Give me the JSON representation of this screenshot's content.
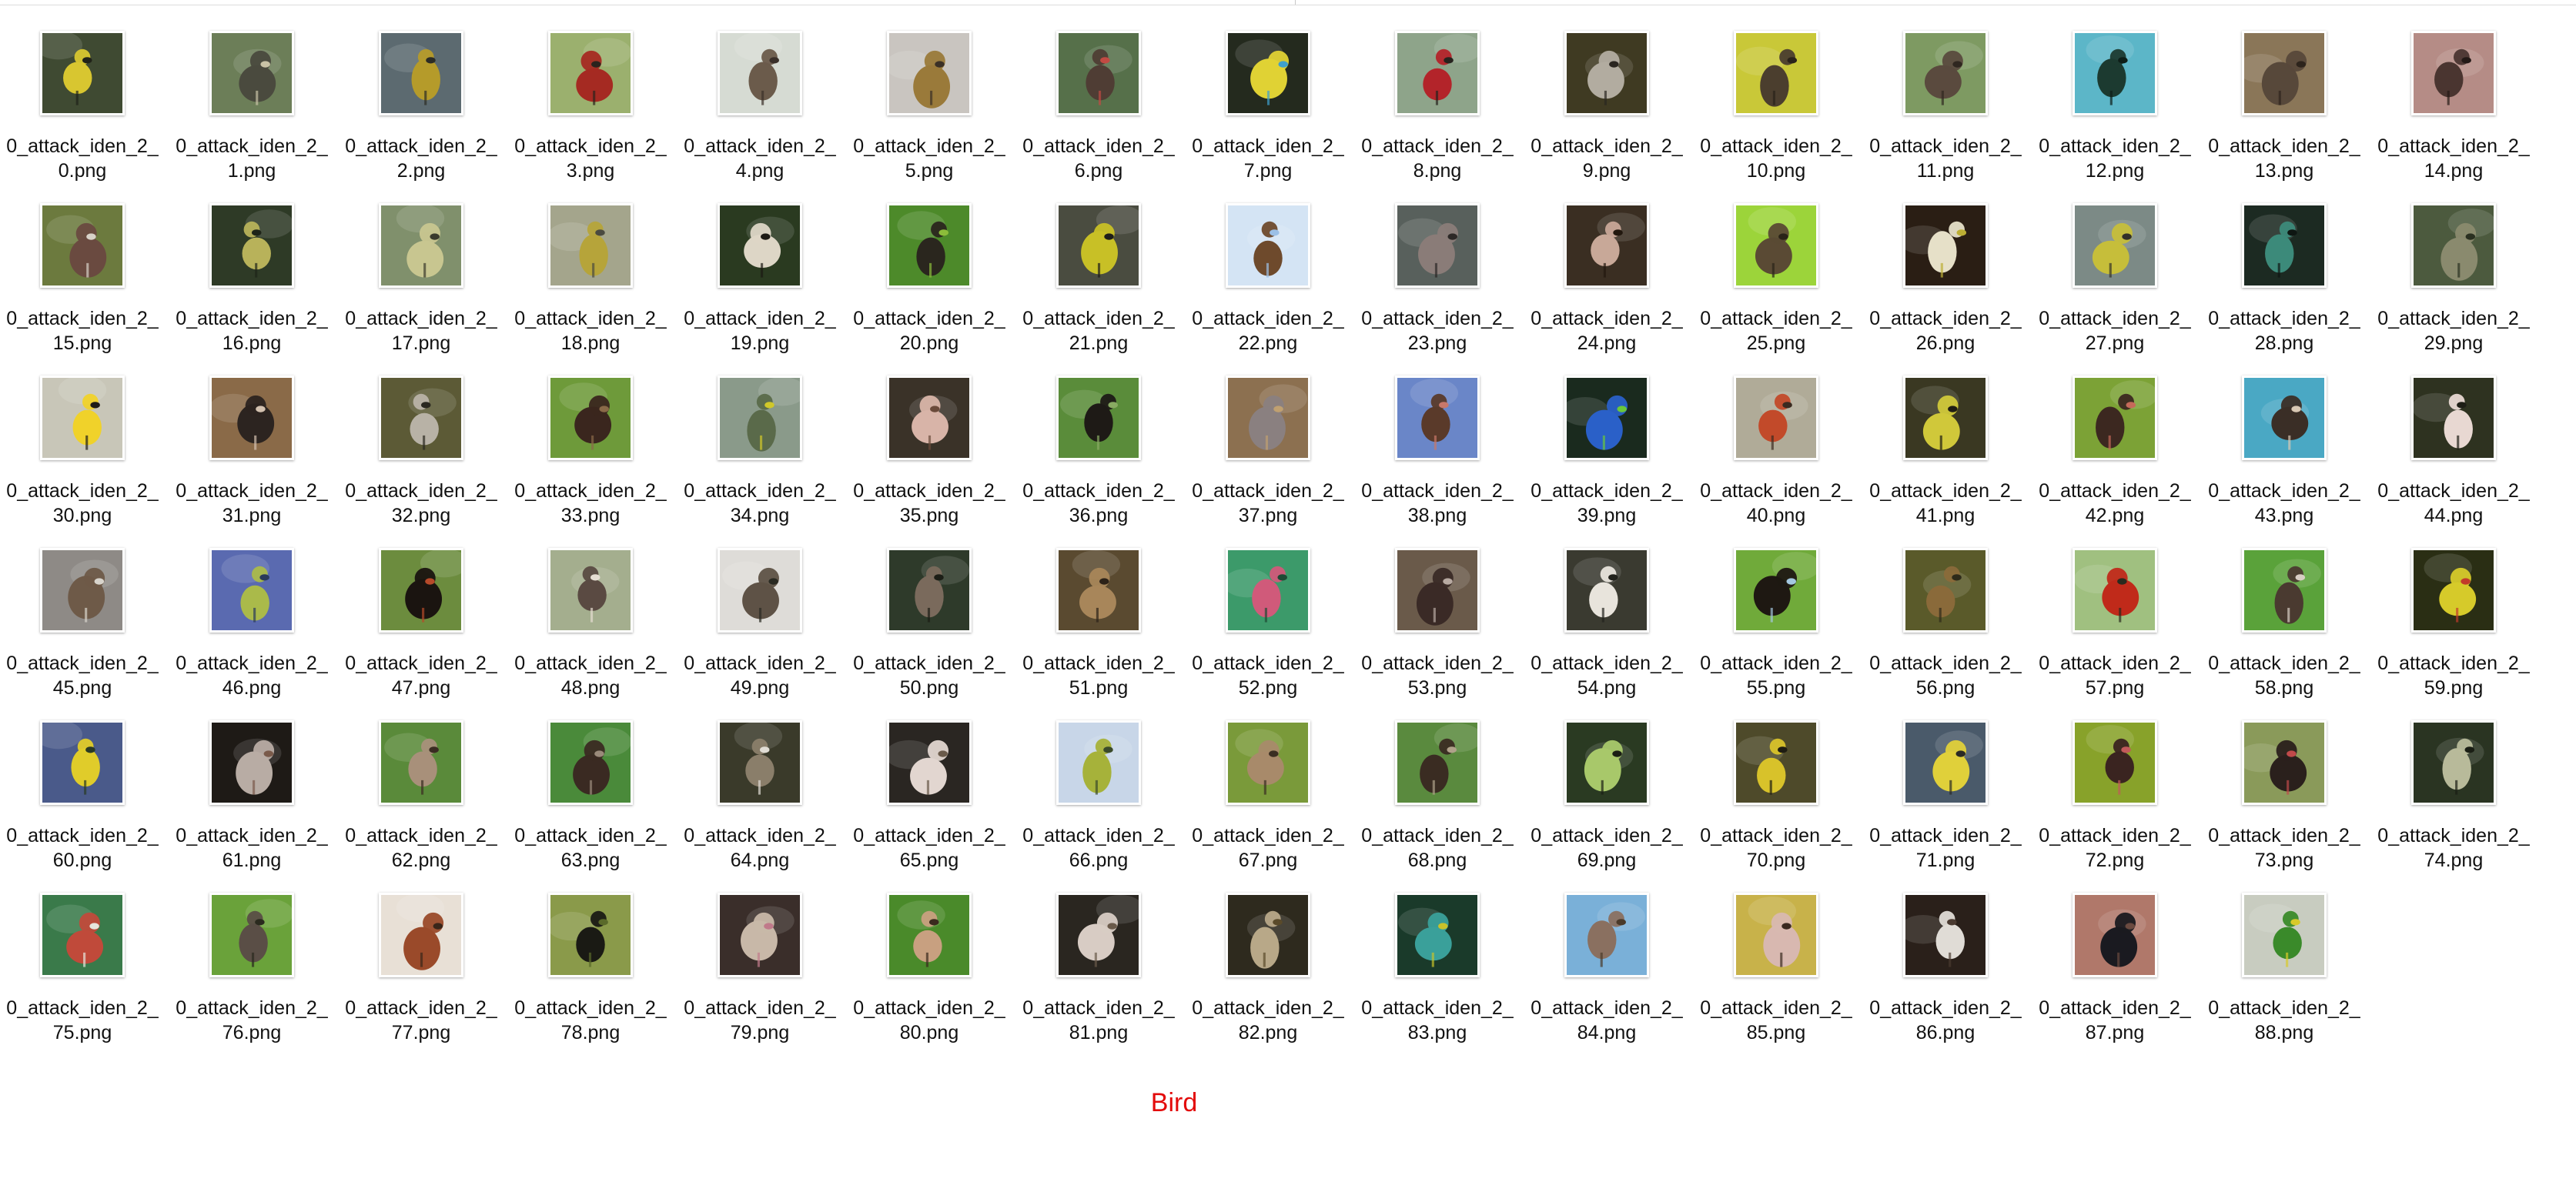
{
  "window": {
    "caption": "Bird"
  },
  "files": [
    {
      "line1": "0_attack_iden_2_",
      "line2": "0.png",
      "bg": "#3f4a32",
      "subject": "#d8c630",
      "accent": "#202218"
    },
    {
      "line1": "0_attack_iden_2_",
      "line2": "1.png",
      "bg": "#6c7e58",
      "subject": "#4a4a3e",
      "accent": "#c9c3a6"
    },
    {
      "line1": "0_attack_iden_2_",
      "line2": "2.png",
      "bg": "#5c6a70",
      "subject": "#b59b2a",
      "accent": "#2c2c25"
    },
    {
      "line1": "0_attack_iden_2_",
      "line2": "3.png",
      "bg": "#9bb06e",
      "subject": "#a52a22",
      "accent": "#2b231d"
    },
    {
      "line1": "0_attack_iden_2_",
      "line2": "4.png",
      "bg": "#d6dbd3",
      "subject": "#6b5b4b",
      "accent": "#3a302a"
    },
    {
      "line1": "0_attack_iden_2_",
      "line2": "5.png",
      "bg": "#c9c5c0",
      "subject": "#9a7a3a",
      "accent": "#3a3026"
    },
    {
      "line1": "0_attack_iden_2_",
      "line2": "6.png",
      "bg": "#56704a",
      "subject": "#4f3d34",
      "accent": "#c24a43"
    },
    {
      "line1": "0_attack_iden_2_",
      "line2": "7.png",
      "bg": "#242a1e",
      "subject": "#e0d234",
      "accent": "#3fa0cc"
    },
    {
      "line1": "0_attack_iden_2_",
      "line2": "8.png",
      "bg": "#8ea48a",
      "subject": "#b3242a",
      "accent": "#27231e"
    },
    {
      "line1": "0_attack_iden_2_",
      "line2": "9.png",
      "bg": "#3f3a22",
      "subject": "#b2aca0",
      "accent": "#2a2620"
    },
    {
      "line1": "0_attack_iden_2_",
      "line2": "10.png",
      "bg": "#c9c838",
      "subject": "#4b3e2e",
      "accent": "#2a231b"
    },
    {
      "line1": "0_attack_iden_2_",
      "line2": "11.png",
      "bg": "#7e9a62",
      "subject": "#5a4a3e",
      "accent": "#2f2720"
    },
    {
      "line1": "0_attack_iden_2_",
      "line2": "12.png",
      "bg": "#5cb6c8",
      "subject": "#1c3a30",
      "accent": "#0e1e18"
    },
    {
      "line1": "0_attack_iden_2_",
      "line2": "13.png",
      "bg": "#8a7658",
      "subject": "#57483a",
      "accent": "#2d241c"
    },
    {
      "line1": "0_attack_iden_2_",
      "line2": "14.png",
      "bg": "#b58c86",
      "subject": "#4a3530",
      "accent": "#231916"
    },
    {
      "line1": "0_attack_iden_2_",
      "line2": "15.png",
      "bg": "#6c7a3e",
      "subject": "#6a4a40",
      "accent": "#d9d2c8"
    },
    {
      "line1": "0_attack_iden_2_",
      "line2": "16.png",
      "bg": "#2e3a26",
      "subject": "#b8b25a",
      "accent": "#1e2418"
    },
    {
      "line1": "0_attack_iden_2_",
      "line2": "17.png",
      "bg": "#80906c",
      "subject": "#c8c690",
      "accent": "#3a3a2c"
    },
    {
      "line1": "0_attack_iden_2_",
      "line2": "18.png",
      "bg": "#a4a58c",
      "subject": "#b6a43a",
      "accent": "#4a4a40"
    },
    {
      "line1": "0_attack_iden_2_",
      "line2": "19.png",
      "bg": "#2a3a20",
      "subject": "#ddd6c6",
      "accent": "#1c1a14"
    },
    {
      "line1": "0_attack_iden_2_",
      "line2": "20.png",
      "bg": "#4d8a2a",
      "subject": "#2a261e",
      "accent": "#8cbc3a"
    },
    {
      "line1": "0_attack_iden_2_",
      "line2": "21.png",
      "bg": "#4a4c40",
      "subject": "#c8c026",
      "accent": "#1e1e1a"
    },
    {
      "line1": "0_attack_iden_2_",
      "line2": "22.png",
      "bg": "#d4e4f4",
      "subject": "#6e4a2c",
      "accent": "#9cc0e6"
    },
    {
      "line1": "0_attack_iden_2_",
      "line2": "23.png",
      "bg": "#58605c",
      "subject": "#8a7c78",
      "accent": "#2c2826"
    },
    {
      "line1": "0_attack_iden_2_",
      "line2": "24.png",
      "bg": "#3a2e22",
      "subject": "#c8a898",
      "accent": "#22180e"
    },
    {
      "line1": "0_attack_iden_2_",
      "line2": "25.png",
      "bg": "#9cd43a",
      "subject": "#5a4a34",
      "accent": "#2a2418"
    },
    {
      "line1": "0_attack_iden_2_",
      "line2": "26.png",
      "bg": "#2a1e14",
      "subject": "#e6e0c8",
      "accent": "#bcae34"
    },
    {
      "line1": "0_attack_iden_2_",
      "line2": "27.png",
      "bg": "#7c8a86",
      "subject": "#c6be3a",
      "accent": "#32302a"
    },
    {
      "line1": "0_attack_iden_2_",
      "line2": "28.png",
      "bg": "#1c2a22",
      "subject": "#3c8a7a",
      "accent": "#0e1612"
    },
    {
      "line1": "0_attack_iden_2_",
      "line2": "29.png",
      "bg": "#4c5a3e",
      "subject": "#8a8a6e",
      "accent": "#2a3020"
    },
    {
      "line1": "0_attack_iden_2_",
      "line2": "30.png",
      "bg": "#c8c6b8",
      "subject": "#f0d22a",
      "accent": "#1e1c18"
    },
    {
      "line1": "0_attack_iden_2_",
      "line2": "31.png",
      "bg": "#8a6a48",
      "subject": "#2c2420",
      "accent": "#d4c2b0"
    },
    {
      "line1": "0_attack_iden_2_",
      "line2": "32.png",
      "bg": "#5c5a36",
      "subject": "#b8b2a6",
      "accent": "#2a2820"
    },
    {
      "line1": "0_attack_iden_2_",
      "line2": "33.png",
      "bg": "#6e9a3a",
      "subject": "#3a261e",
      "accent": "#8a6a48"
    },
    {
      "line1": "0_attack_iden_2_",
      "line2": "34.png",
      "bg": "#8a9a8a",
      "subject": "#5a6a4a",
      "accent": "#d0c82a"
    },
    {
      "line1": "0_attack_iden_2_",
      "line2": "35.png",
      "bg": "#3a3228",
      "subject": "#d8b4a8",
      "accent": "#6a4a3a"
    },
    {
      "line1": "0_attack_iden_2_",
      "line2": "36.png",
      "bg": "#5a8c3a",
      "subject": "#1e1a16",
      "accent": "#88aa62"
    },
    {
      "line1": "0_attack_iden_2_",
      "line2": "37.png",
      "bg": "#8c7050",
      "subject": "#8a8080",
      "accent": "#c0a070"
    },
    {
      "line1": "0_attack_iden_2_",
      "line2": "38.png",
      "bg": "#6a86c8",
      "subject": "#5a3a2a",
      "accent": "#c8786a"
    },
    {
      "line1": "0_attack_iden_2_",
      "line2": "39.png",
      "bg": "#1a2a1e",
      "subject": "#2a60c8",
      "accent": "#6ac83a"
    },
    {
      "line1": "0_attack_iden_2_",
      "line2": "40.png",
      "bg": "#b0ab98",
      "subject": "#c24a2a",
      "accent": "#3a2a20"
    },
    {
      "line1": "0_attack_iden_2_",
      "line2": "41.png",
      "bg": "#3a3822",
      "subject": "#d0c83a",
      "accent": "#1e1c14"
    },
    {
      "line1": "0_attack_iden_2_",
      "line2": "42.png",
      "bg": "#7ca236",
      "subject": "#3c2820",
      "accent": "#c66a5a"
    },
    {
      "line1": "0_attack_iden_2_",
      "line2": "43.png",
      "bg": "#4aa8c4",
      "subject": "#3a2e26",
      "accent": "#d8c8b4"
    },
    {
      "line1": "0_attack_iden_2_",
      "line2": "44.png",
      "bg": "#2e3220",
      "subject": "#e8d8d2",
      "accent": "#1e1e16"
    },
    {
      "line1": "0_attack_iden_2_",
      "line2": "45.png",
      "bg": "#8e8a86",
      "subject": "#6e5a48",
      "accent": "#d8d4cc"
    },
    {
      "line1": "0_attack_iden_2_",
      "line2": "46.png",
      "bg": "#5a6ab0",
      "subject": "#aaba4a",
      "accent": "#2a3a5a"
    },
    {
      "line1": "0_attack_iden_2_",
      "line2": "47.png",
      "bg": "#6c8c3e",
      "subject": "#1a1410",
      "accent": "#b64a2a"
    },
    {
      "line1": "0_attack_iden_2_",
      "line2": "48.png",
      "bg": "#a4ae8e",
      "subject": "#5a4a42",
      "accent": "#e6ddd2"
    },
    {
      "line1": "0_attack_iden_2_",
      "line2": "49.png",
      "bg": "#dedcd8",
      "subject": "#5e5246",
      "accent": "#2a2a22"
    },
    {
      "line1": "0_attack_iden_2_",
      "line2": "50.png",
      "bg": "#2e3a2a",
      "subject": "#7a6a5c",
      "accent": "#1c1e16"
    },
    {
      "line1": "0_attack_iden_2_",
      "line2": "51.png",
      "bg": "#5a4a30",
      "subject": "#a8865a",
      "accent": "#2c2218"
    },
    {
      "line1": "0_attack_iden_2_",
      "line2": "52.png",
      "bg": "#3c9a6a",
      "subject": "#d05a7a",
      "accent": "#1e4a34"
    },
    {
      "line1": "0_attack_iden_2_",
      "line2": "53.png",
      "bg": "#6a5a4a",
      "subject": "#3a2a26",
      "accent": "#b8aaa2"
    },
    {
      "line1": "0_attack_iden_2_",
      "line2": "54.png",
      "bg": "#3a3a30",
      "subject": "#e8e4dc",
      "accent": "#22221c"
    },
    {
      "line1": "0_attack_iden_2_",
      "line2": "55.png",
      "bg": "#70aa3a",
      "subject": "#1e1812",
      "accent": "#a4c8e0"
    },
    {
      "line1": "0_attack_iden_2_",
      "line2": "56.png",
      "bg": "#5a5a2a",
      "subject": "#8a6a3a",
      "accent": "#2e2a1a"
    },
    {
      "line1": "0_attack_iden_2_",
      "line2": "57.png",
      "bg": "#a0c080",
      "subject": "#c02a1a",
      "accent": "#2a2a1e"
    },
    {
      "line1": "0_attack_iden_2_",
      "line2": "58.png",
      "bg": "#5aa23a",
      "subject": "#4a3a30",
      "accent": "#d8cec4"
    },
    {
      "line1": "0_attack_iden_2_",
      "line2": "59.png",
      "bg": "#2a2e14",
      "subject": "#d6ca2a",
      "accent": "#c23a2a"
    },
    {
      "line1": "0_attack_iden_2_",
      "line2": "60.png",
      "bg": "#4a5a8a",
      "subject": "#e0cc2a",
      "accent": "#2a3a24"
    },
    {
      "line1": "0_attack_iden_2_",
      "line2": "61.png",
      "bg": "#1e1a16",
      "subject": "#b8aca4",
      "accent": "#7a5a4a"
    },
    {
      "line1": "0_attack_iden_2_",
      "line2": "62.png",
      "bg": "#5a8a3a",
      "subject": "#a8907a",
      "accent": "#3a2c22"
    },
    {
      "line1": "0_attack_iden_2_",
      "line2": "63.png",
      "bg": "#4a8a3a",
      "subject": "#3a2a22",
      "accent": "#9a8a7a"
    },
    {
      "line1": "0_attack_iden_2_",
      "line2": "64.png",
      "bg": "#3a3a2a",
      "subject": "#8a7e6a",
      "accent": "#e0dcd4"
    },
    {
      "line1": "0_attack_iden_2_",
      "line2": "65.png",
      "bg": "#2a2622",
      "subject": "#e2d6d0",
      "accent": "#6a5a4a"
    },
    {
      "line1": "0_attack_iden_2_",
      "line2": "66.png",
      "bg": "#c8d6e8",
      "subject": "#a6b23a",
      "accent": "#3a4a2a"
    },
    {
      "line1": "0_attack_iden_2_",
      "line2": "67.png",
      "bg": "#7a9a3a",
      "subject": "#a88a6a",
      "accent": "#3a2e22"
    },
    {
      "line1": "0_attack_iden_2_",
      "line2": "68.png",
      "bg": "#5a8a3e",
      "subject": "#3a2c22",
      "accent": "#b0a28a"
    },
    {
      "line1": "0_attack_iden_2_",
      "line2": "69.png",
      "bg": "#2a3a22",
      "subject": "#a8c86a",
      "accent": "#1a1e14"
    },
    {
      "line1": "0_attack_iden_2_",
      "line2": "70.png",
      "bg": "#4e4a2a",
      "subject": "#d8c22a",
      "accent": "#1e1c12"
    },
    {
      "line1": "0_attack_iden_2_",
      "line2": "71.png",
      "bg": "#4a5a6a",
      "subject": "#e0d03a",
      "accent": "#2a2a24"
    },
    {
      "line1": "0_attack_iden_2_",
      "line2": "72.png",
      "bg": "#88a22a",
      "subject": "#3a2420",
      "accent": "#c25a5a"
    },
    {
      "line1": "0_attack_iden_2_",
      "line2": "73.png",
      "bg": "#8a9a5a",
      "subject": "#2a201c",
      "accent": "#c04a4a"
    },
    {
      "line1": "0_attack_iden_2_",
      "line2": "74.png",
      "bg": "#2a3422",
      "subject": "#b8ba9a",
      "accent": "#1a1e14"
    },
    {
      "line1": "0_attack_iden_2_",
      "line2": "75.png",
      "bg": "#3a7a4a",
      "subject": "#c04a3a",
      "accent": "#e6e6dc"
    },
    {
      "line1": "0_attack_iden_2_",
      "line2": "76.png",
      "bg": "#6aa23a",
      "subject": "#5a4e46",
      "accent": "#2a2a1e"
    },
    {
      "line1": "0_attack_iden_2_",
      "line2": "77.png",
      "bg": "#e8e0d6",
      "subject": "#9a4a2a",
      "accent": "#3a261a"
    },
    {
      "line1": "0_attack_iden_2_",
      "line2": "78.png",
      "bg": "#8a9a4a",
      "subject": "#1a1a14",
      "accent": "#5a6a2a"
    },
    {
      "line1": "0_attack_iden_2_",
      "line2": "79.png",
      "bg": "#3a2e2a",
      "subject": "#c8b8a8",
      "accent": "#c07a8a"
    },
    {
      "line1": "0_attack_iden_2_",
      "line2": "80.png",
      "bg": "#4a8a2a",
      "subject": "#c8a080",
      "accent": "#3a2a1e"
    },
    {
      "line1": "0_attack_iden_2_",
      "line2": "81.png",
      "bg": "#2a2620",
      "subject": "#d8ccc4",
      "accent": "#6a5a4a"
    },
    {
      "line1": "0_attack_iden_2_",
      "line2": "82.png",
      "bg": "#2e2a1e",
      "subject": "#b8a888",
      "accent": "#5a4a2a"
    },
    {
      "line1": "0_attack_iden_2_",
      "line2": "83.png",
      "bg": "#1a3a2a",
      "subject": "#3aa09a",
      "accent": "#c8c22a"
    },
    {
      "line1": "0_attack_iden_2_",
      "line2": "84.png",
      "bg": "#7ab0d8",
      "subject": "#8a7060",
      "accent": "#4a3a2a"
    },
    {
      "line1": "0_attack_iden_2_",
      "line2": "85.png",
      "bg": "#c8b24a",
      "subject": "#d8b8b0",
      "accent": "#3a2a20"
    },
    {
      "line1": "0_attack_iden_2_",
      "line2": "86.png",
      "bg": "#2a201a",
      "subject": "#e0dcd6",
      "accent": "#4a3a30"
    },
    {
      "line1": "0_attack_iden_2_",
      "line2": "87.png",
      "bg": "#b0786a",
      "subject": "#1a1a20",
      "accent": "#6a4a40"
    },
    {
      "line1": "0_attack_iden_2_",
      "line2": "88.png",
      "bg": "#c8ccc0",
      "subject": "#3a8a2a",
      "accent": "#d8ca2a"
    }
  ]
}
